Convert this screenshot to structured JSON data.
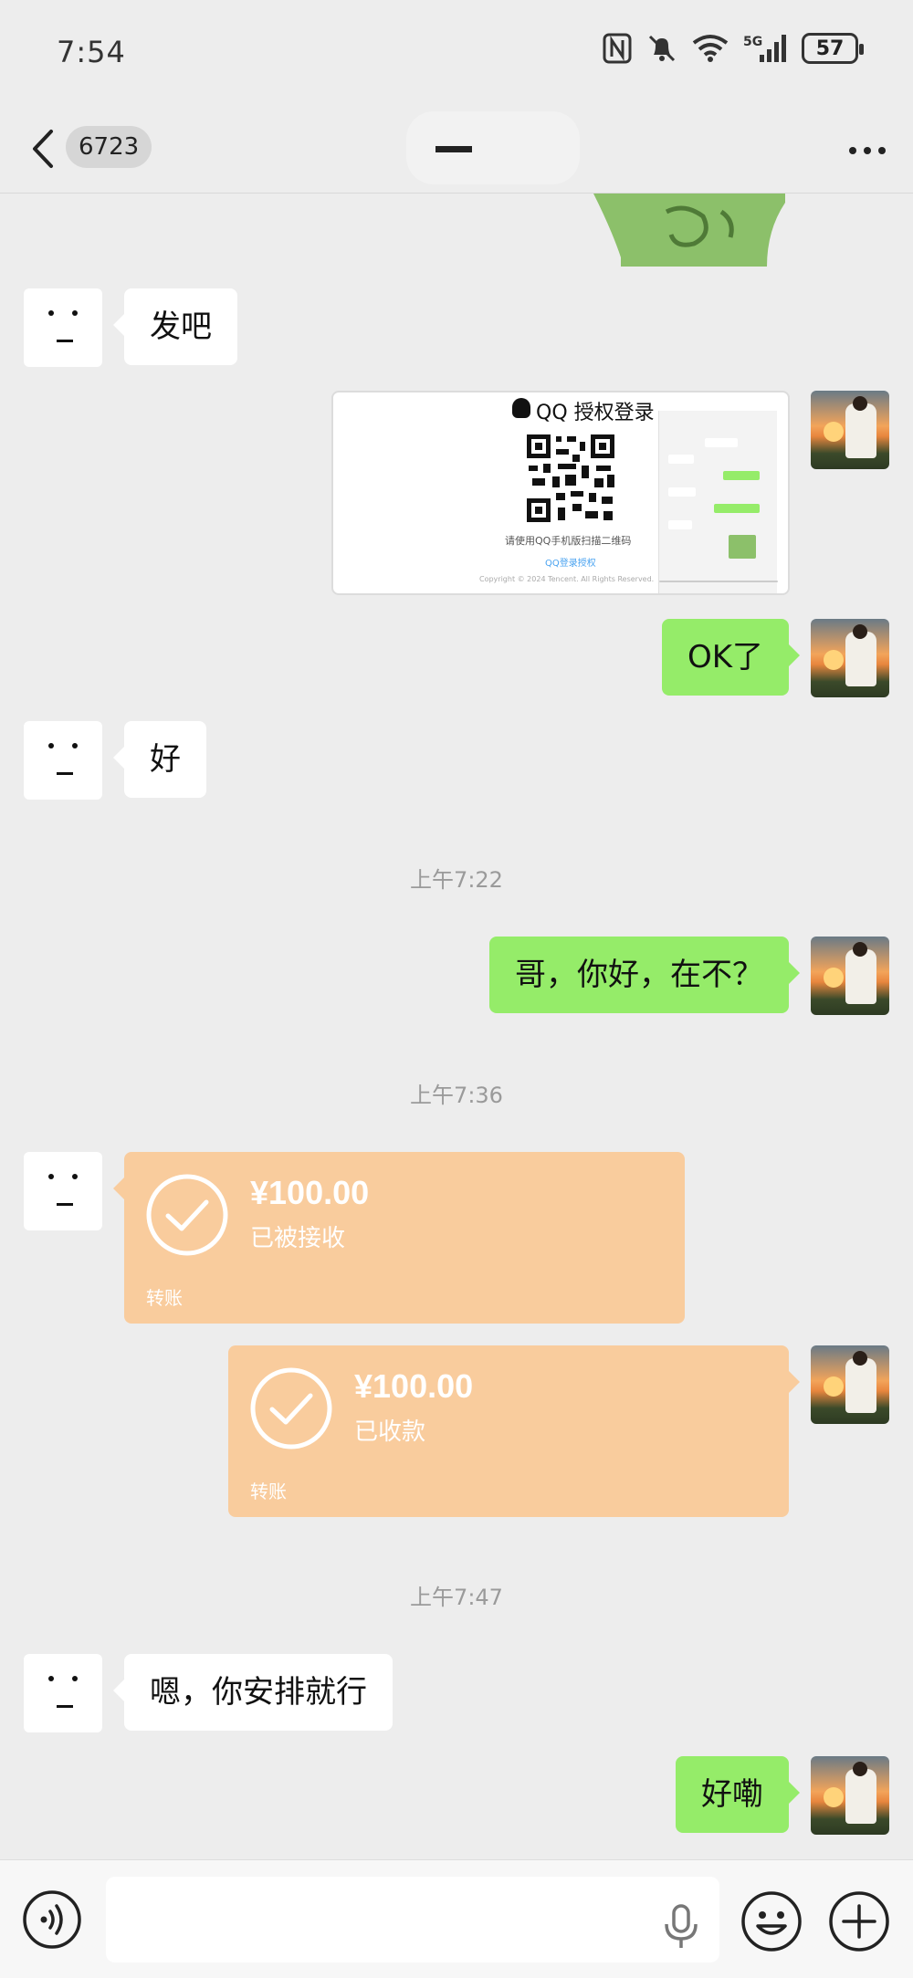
{
  "status_bar": {
    "time": "7:54",
    "network": "5G",
    "battery": "57"
  },
  "header": {
    "unread_count": "6723",
    "title": ""
  },
  "messages": [
    {
      "id": "m1",
      "side": "left",
      "type": "text",
      "text": "发吧"
    },
    {
      "id": "m2",
      "side": "right",
      "type": "image",
      "image": {
        "title": "QQ 授权登录",
        "caption": "请使用QQ手机版扫描二维码",
        "link": "QQ登录授权",
        "copyright": "Copyright © 2024 Tencent. All Rights Reserved."
      }
    },
    {
      "id": "m3",
      "side": "right",
      "type": "text",
      "text": "OK了"
    },
    {
      "id": "m4",
      "side": "left",
      "type": "text",
      "text": "好"
    },
    {
      "id": "t1",
      "type": "timestamp",
      "text": "上午7:22"
    },
    {
      "id": "m5",
      "side": "right",
      "type": "text",
      "text": "哥，你好，在不？"
    },
    {
      "id": "t2",
      "type": "timestamp",
      "text": "上午7:36"
    },
    {
      "id": "m6",
      "side": "left",
      "type": "transfer",
      "amount": "¥100.00",
      "status": "已被接收",
      "label": "转账"
    },
    {
      "id": "m7",
      "side": "right",
      "type": "transfer",
      "amount": "¥100.00",
      "status": "已收款",
      "label": "转账"
    },
    {
      "id": "t3",
      "type": "timestamp",
      "text": "上午7:47"
    },
    {
      "id": "m8",
      "side": "left",
      "type": "text",
      "text": "嗯，你安排就行"
    },
    {
      "id": "m9",
      "side": "right",
      "type": "text",
      "text": "好嘞"
    }
  ],
  "input_bar": {
    "placeholder": "",
    "icons": [
      "voice-icon",
      "microphone-icon",
      "emoji-icon",
      "plus-icon"
    ]
  },
  "colors": {
    "background": "#ededed",
    "bubble_self": "#95ec69",
    "bubble_other": "#ffffff",
    "transfer": "#f9cc9d"
  }
}
